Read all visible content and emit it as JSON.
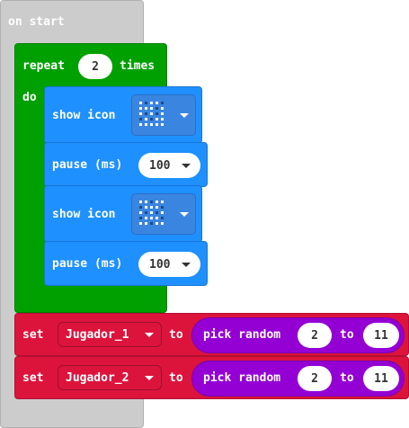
{
  "colors": {
    "event": "#cccccc",
    "loop": "#00a000",
    "basic": "#1e90ff",
    "variable": "#dc143c",
    "math": "#9400d3",
    "led_on": "#ffffff",
    "led_off": "#1b4a8f"
  },
  "on_start": {
    "label": "on start"
  },
  "repeat_block": {
    "label": "repeat",
    "count": "2",
    "times_label": "times",
    "do_label": "do"
  },
  "blocks": [
    {
      "type": "show_icon",
      "label": "show icon",
      "icon": "yes-icon",
      "leds": [
        1,
        0,
        1,
        1,
        0,
        1,
        1,
        1,
        0,
        1,
        1,
        0,
        1,
        0,
        1,
        0,
        1,
        0,
        1,
        1,
        1,
        1,
        1,
        1,
        1
      ]
    },
    {
      "type": "pause",
      "label": "pause (ms)",
      "value": "100"
    },
    {
      "type": "show_icon",
      "label": "show icon",
      "icon": "no-icon",
      "leds": [
        1,
        1,
        0,
        1,
        1,
        0,
        1,
        1,
        1,
        0,
        1,
        0,
        1,
        0,
        1,
        0,
        1,
        1,
        1,
        0,
        1,
        1,
        0,
        1,
        1
      ]
    },
    {
      "type": "pause",
      "label": "pause (ms)",
      "value": "100"
    }
  ],
  "set_blocks": [
    {
      "set_label": "set",
      "variable": "Jugador_1",
      "to_label": "to",
      "random": {
        "label": "pick random",
        "min": "2",
        "to_label": "to",
        "max": "11"
      }
    },
    {
      "set_label": "set",
      "variable": "Jugador_2",
      "to_label": "to",
      "random": {
        "label": "pick random",
        "min": "2",
        "to_label": "to",
        "max": "11"
      }
    }
  ]
}
